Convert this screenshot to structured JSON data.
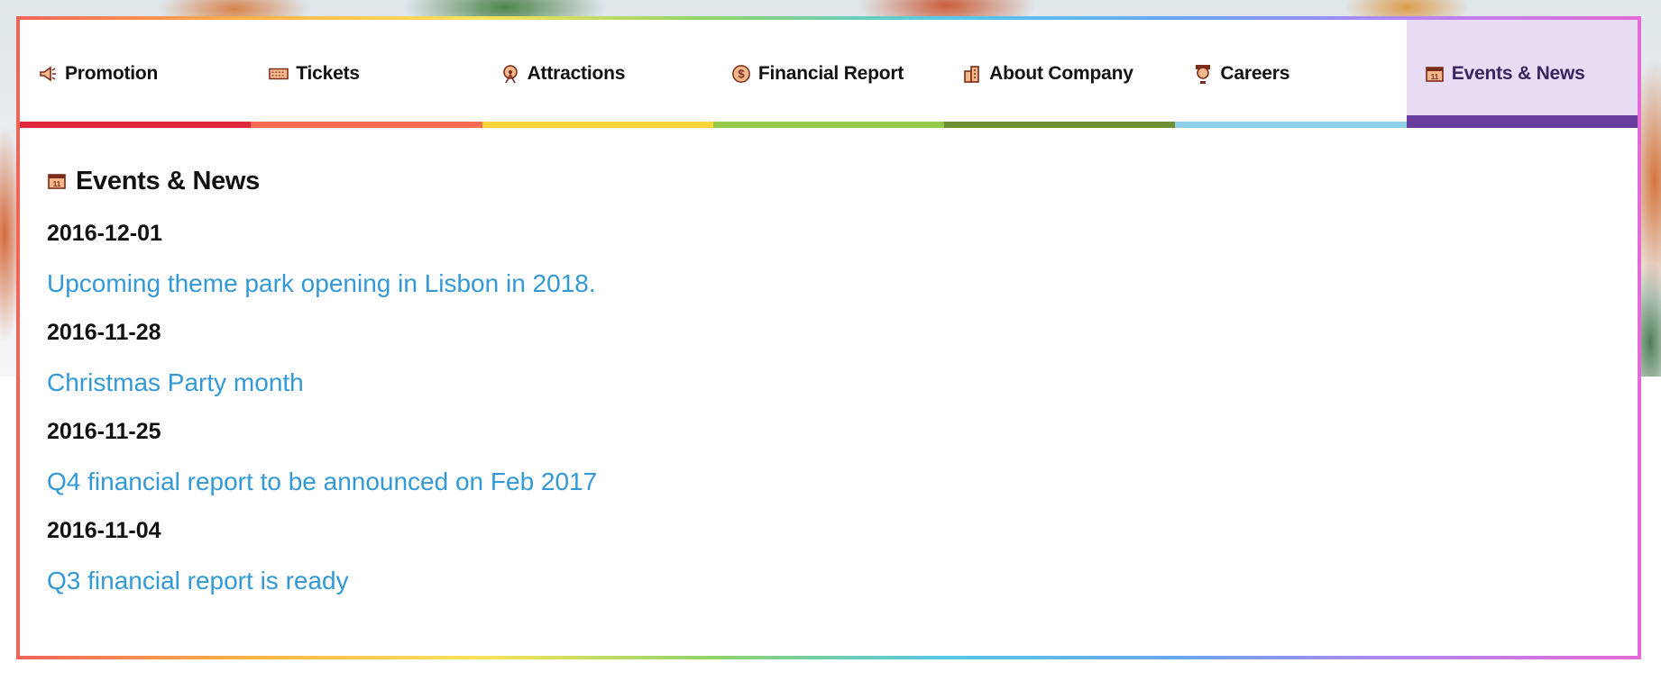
{
  "nav": {
    "tabs": [
      {
        "label": "Promotion",
        "icon": "megaphone-icon",
        "color": "#e0283c"
      },
      {
        "label": "Tickets",
        "icon": "ticket-icon",
        "color": "#f76b55"
      },
      {
        "label": "Attractions",
        "icon": "ferris-wheel-icon",
        "color": "#fdd53b"
      },
      {
        "label": "Financial Report",
        "icon": "dollar-coin-icon",
        "color": "#94c94c"
      },
      {
        "label": "About Company",
        "icon": "building-icon",
        "color": "#6e8e31"
      },
      {
        "label": "Careers",
        "icon": "person-icon",
        "color": "#8fcfe9"
      },
      {
        "label": "Events & News",
        "icon": "calendar-icon",
        "color": "#673d9e",
        "active": true
      }
    ]
  },
  "main": {
    "title": "Events & News",
    "title_icon": "calendar-icon",
    "news": [
      {
        "date": "2016-12-01",
        "headline": "Upcoming theme park opening in Lisbon in 2018."
      },
      {
        "date": "2016-11-28",
        "headline": "Christmas Party month"
      },
      {
        "date": "2016-11-25",
        "headline": "Q4 financial report to be announced on Feb 2017"
      },
      {
        "date": "2016-11-04",
        "headline": "Q3 financial report is ready"
      }
    ]
  },
  "colors": {
    "link": "#3399d6",
    "active_tab_bg": "#e8dcf5"
  }
}
